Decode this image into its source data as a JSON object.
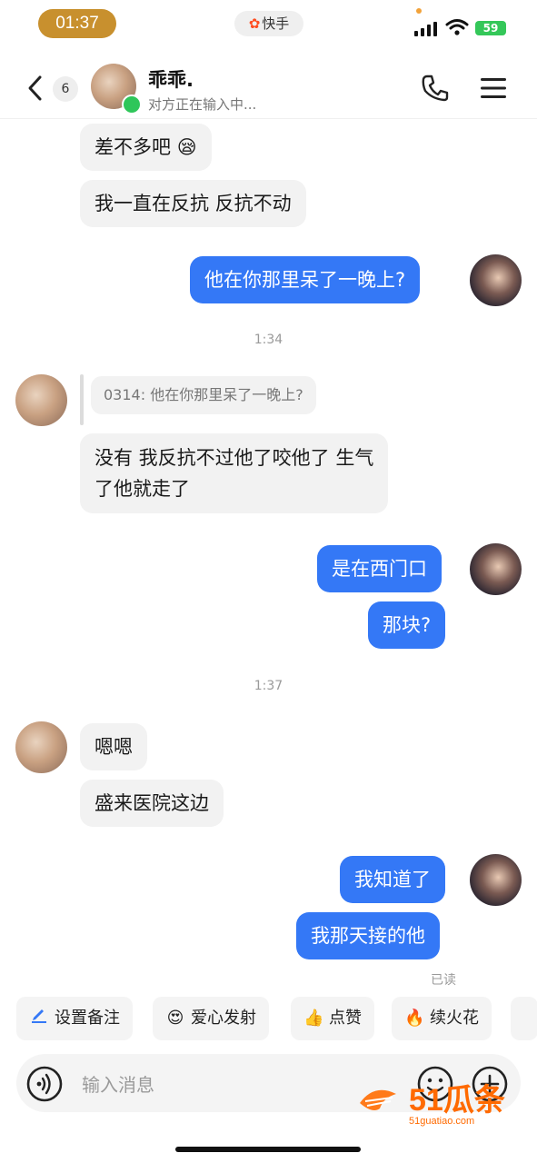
{
  "status_bar": {
    "time": "01:37",
    "app_name": "快手",
    "battery": "59"
  },
  "header": {
    "unread_count": "6",
    "contact_name": "乖乖.",
    "typing_status": "对方正在输入中..."
  },
  "messages": {
    "m1": "差不多吧",
    "m1_emoji": "😪",
    "m2": "我一直在反抗 反抗不动",
    "m3": "他在你那里呆了一晚上?",
    "ts1": "1:34",
    "quote": "0314: 他在你那里呆了一晚上?",
    "m4_line1": "没有 我反抗不过他了咬他了 生气",
    "m4_line2": "了他就走了",
    "m5": "是在西门口",
    "m6": "那块?",
    "ts2": "1:37",
    "m7": "嗯嗯",
    "m8": "盛来医院这边",
    "m9": "我知道了",
    "m10": "我那天接的他",
    "read_receipt": "已读"
  },
  "quick_actions": [
    {
      "label": "设置备注",
      "icon": "pencil-icon"
    },
    {
      "label": "爱心发射",
      "icon": "heart-eyes-icon"
    },
    {
      "label": "点赞",
      "icon": "thumbs-up-icon"
    },
    {
      "label": "续火花",
      "icon": "fire-icon"
    }
  ],
  "input": {
    "placeholder": "输入消息"
  },
  "watermark": {
    "text": "51瓜条",
    "url_text": "51guatiao.com"
  },
  "colors": {
    "outgoing_bubble": "#3478f6",
    "incoming_bubble": "#f2f2f2",
    "online": "#2fc65a",
    "time_pill": "#c8902e"
  }
}
